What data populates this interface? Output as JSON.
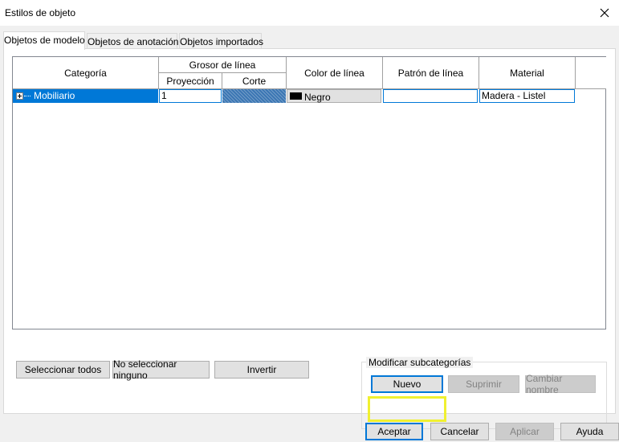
{
  "window": {
    "title": "Estilos de objeto"
  },
  "tabs": [
    {
      "label": "Objetos de modelo",
      "active": true
    },
    {
      "label": "Objetos de anotación",
      "active": false
    },
    {
      "label": "Objetos importados",
      "active": false
    }
  ],
  "grid": {
    "headers": {
      "categoria": "Categoría",
      "grosor": "Grosor de línea",
      "proyeccion": "Proyección",
      "corte": "Corte",
      "color": "Color de línea",
      "patron": "Patrón de línea",
      "material": "Material"
    },
    "rows": [
      {
        "categoria": "Mobiliario",
        "proyeccion": "1",
        "corte": "",
        "color": "Negro",
        "color_hex": "#000000",
        "patron": "",
        "material": "Madera - Listel"
      }
    ]
  },
  "selection_buttons": {
    "select_all": "Seleccionar todos",
    "select_none": "No seleccionar ninguno",
    "invert": "Invertir"
  },
  "subcategories": {
    "legend": "Modificar subcategorías",
    "new": "Nuevo",
    "delete": "Suprimir",
    "rename": "Cambiar nombre"
  },
  "footer": {
    "ok": "Aceptar",
    "cancel": "Cancelar",
    "apply": "Aplicar",
    "help": "Ayuda"
  },
  "colors": {
    "selection": "#0078d7",
    "highlight": "#f0f030"
  }
}
